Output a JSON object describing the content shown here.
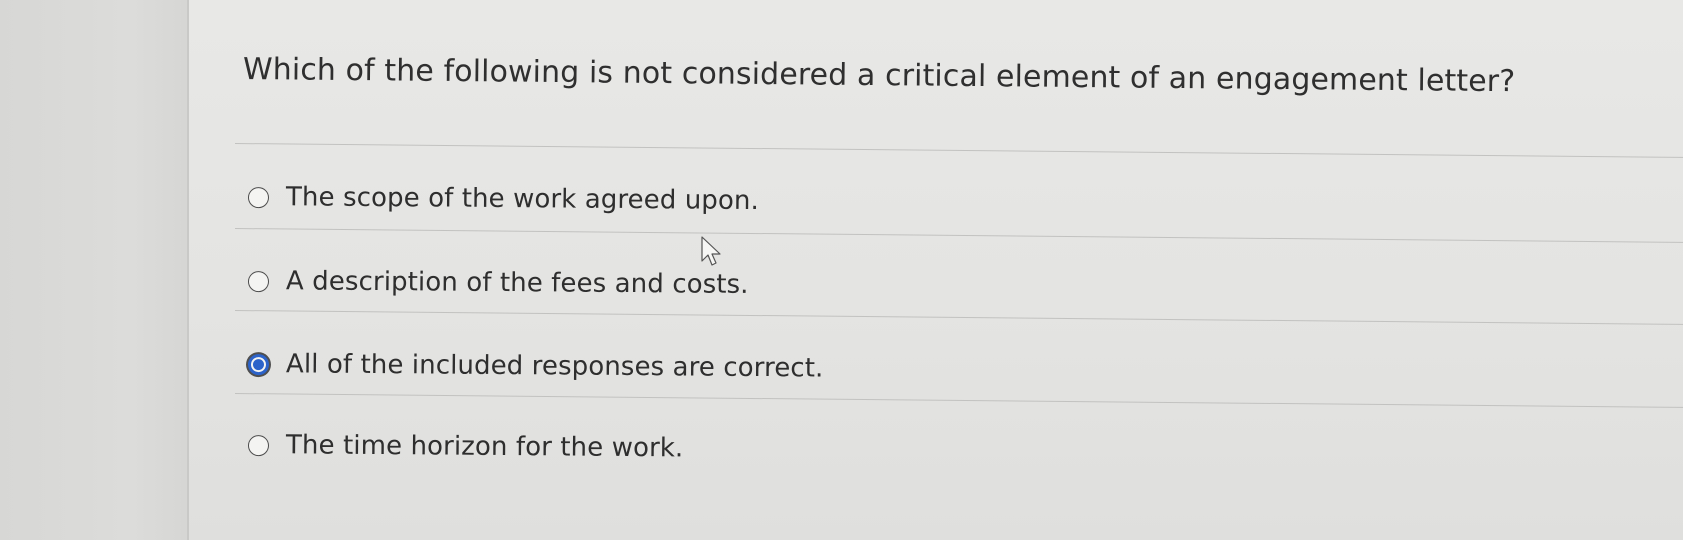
{
  "question": {
    "text": "Which of the following is not considered a critical element of an engagement letter?"
  },
  "options": [
    {
      "label": "The scope of the work agreed upon.",
      "selected": false
    },
    {
      "label": "A description of the fees and costs.",
      "selected": false
    },
    {
      "label": "All of the included responses are correct.",
      "selected": true
    },
    {
      "label": "The time horizon for the work.",
      "selected": false
    }
  ],
  "colors": {
    "selected_radio": "#2c63c9",
    "text": "#2e2e2e",
    "background": "#e4e4e2"
  },
  "icons": {
    "cursor": "mouse-pointer-icon"
  }
}
